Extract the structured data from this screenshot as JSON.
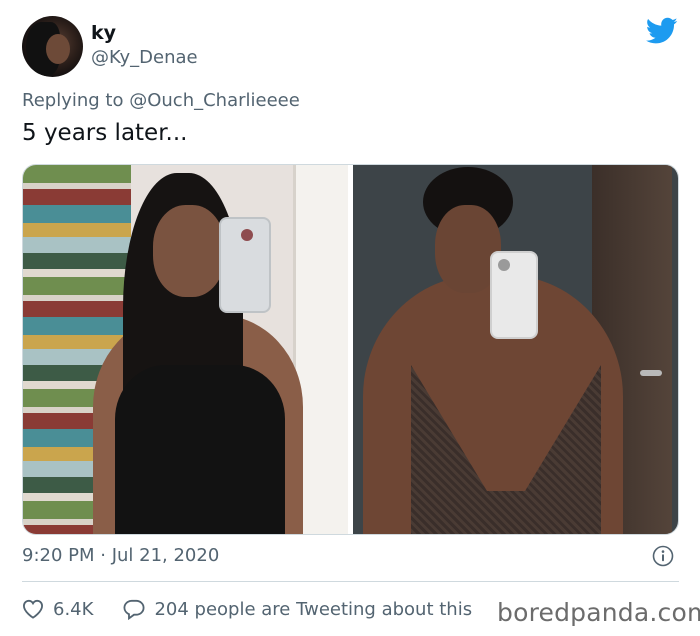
{
  "tweet": {
    "author": {
      "display_name": "ky",
      "handle": "@Ky_Denae",
      "avatar_icon": "avatar-photo"
    },
    "brand_icon": "twitter-bird-icon",
    "brand_color": "#1d9bf0",
    "reply": {
      "prefix": "Replying to",
      "mention": "@Ouch_Charlieeee"
    },
    "text": "5 years later...",
    "media": [
      {
        "label": "left-selfie-photo"
      },
      {
        "label": "right-selfie-photo"
      }
    ],
    "timestamp": "9:20 PM · Jul 21, 2020",
    "likes": "6.4K",
    "tweeting_text": "204 people are Tweeting about this",
    "muted_color": "#536471"
  },
  "watermark": "boredpanda.com"
}
